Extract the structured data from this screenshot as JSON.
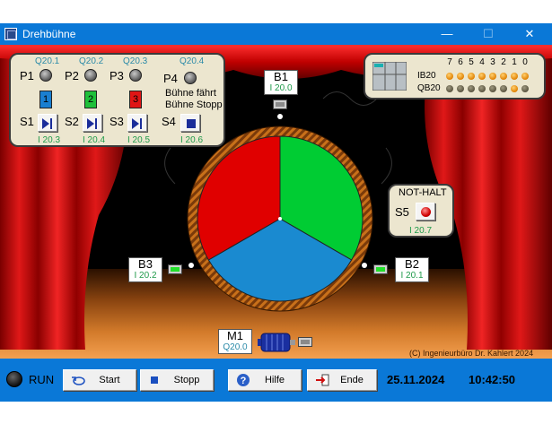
{
  "window": {
    "title": "Drehbühne",
    "minimize": "—",
    "maximize": "☐",
    "close": "✕"
  },
  "control_panel": {
    "lamps": [
      {
        "label": "P1",
        "addr": "Q20.1"
      },
      {
        "label": "P2",
        "addr": "Q20.2"
      },
      {
        "label": "P3",
        "addr": "Q20.3"
      },
      {
        "label": "P4",
        "addr": "Q20.4"
      }
    ],
    "indicators": [
      {
        "text": "1",
        "color": "#1a7fd0"
      },
      {
        "text": "2",
        "color": "#1fc03a"
      },
      {
        "text": "3",
        "color": "#e01515"
      }
    ],
    "p4_text_1": "Bühne fährt",
    "p4_text_2": "Bühne Stopp",
    "buttons": [
      {
        "label": "S1",
        "addr": "I 20.3"
      },
      {
        "label": "S2",
        "addr": "I 20.4"
      },
      {
        "label": "S3",
        "addr": "I 20.5"
      },
      {
        "label": "S4",
        "addr": "I 20.6"
      }
    ]
  },
  "sensors": {
    "b1": {
      "name": "B1",
      "addr": "I 20.0"
    },
    "b2": {
      "name": "B2",
      "addr": "I 20.1"
    },
    "b3": {
      "name": "B3",
      "addr": "I 20.2"
    }
  },
  "notaus": {
    "title": "NOT-HALT",
    "label": "S5",
    "addr": "I 20.7"
  },
  "motor": {
    "name": "M1",
    "addr": "Q20.0"
  },
  "io_panel": {
    "bits": [
      "7",
      "6",
      "5",
      "4",
      "3",
      "2",
      "1",
      "0"
    ],
    "ib_label": "IB20",
    "qb_label": "QB20",
    "ib_states": [
      "orange",
      "orange",
      "orange",
      "orange",
      "orange",
      "orange",
      "orange",
      "orange"
    ],
    "qb_states": [
      "off",
      "off",
      "off",
      "off",
      "off",
      "off",
      "orange",
      "off"
    ]
  },
  "turntable": {
    "segments": [
      {
        "color": "#00cc33"
      },
      {
        "color": "#1a8ad0"
      },
      {
        "color": "#e00000"
      }
    ]
  },
  "copyright": "(C) Ingenieurbüro Dr. Kahlert 2024",
  "toolbar": {
    "run_label": "RUN",
    "start": "Start",
    "stop": "Stopp",
    "help": "Hilfe",
    "exit": "Ende",
    "date": "25.11.2024",
    "time": "10:42:50"
  }
}
